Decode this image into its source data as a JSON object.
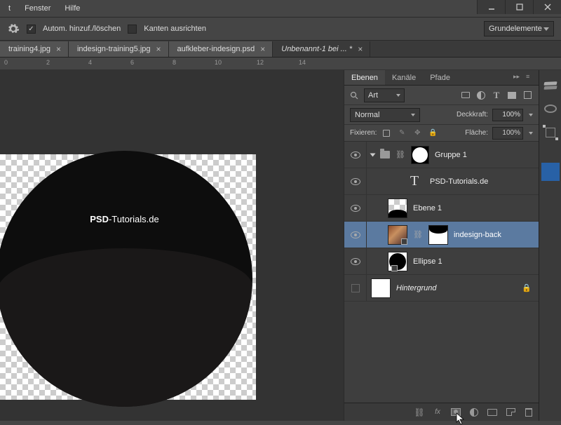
{
  "menubar": {
    "items": [
      "t",
      "Fenster",
      "Hilfe"
    ]
  },
  "options": {
    "auto_add_label": "Autom. hinzuf./löschen",
    "auto_add_checked": true,
    "align_edges_label": "Kanten ausrichten",
    "align_edges_checked": false,
    "tool_preset": "Grundelemente"
  },
  "tabs": [
    {
      "label": "training4.jpg",
      "active": false
    },
    {
      "label": "indesign-training5.jpg",
      "active": false
    },
    {
      "label": "aufkleber-indesign.psd",
      "active": false
    },
    {
      "label": "Unbenannt-1 bei ... *",
      "active": true
    }
  ],
  "ruler_ticks": [
    "0",
    "2",
    "4",
    "6",
    "8",
    "10",
    "12",
    "14"
  ],
  "canvas": {
    "watermark_bold": "PSD",
    "watermark_rest": "-Tutorials.de"
  },
  "panel": {
    "tabs": [
      "Ebenen",
      "Kanäle",
      "Pfade"
    ],
    "filter_kind": "Art",
    "blend_mode": "Normal",
    "opacity_label": "Deckkraft:",
    "opacity_value": "100%",
    "fill_label": "Fläche:",
    "fill_value": "100%",
    "lock_label": "Fixieren:"
  },
  "layers": [
    {
      "name": "Gruppe 1"
    },
    {
      "name": "PSD-Tutorials.de"
    },
    {
      "name": "Ebene 1"
    },
    {
      "name": "indesign-back"
    },
    {
      "name": "Ellipse 1"
    },
    {
      "name": "Hintergrund"
    }
  ],
  "footer": {
    "fx": "fx"
  }
}
